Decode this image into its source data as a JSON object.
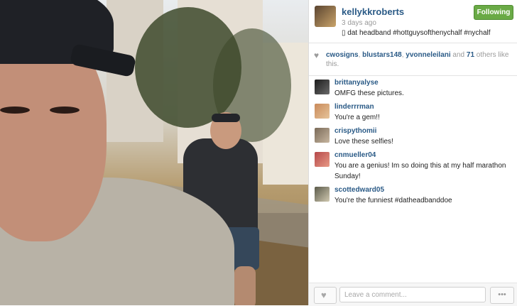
{
  "post": {
    "username": "kellykkroberts",
    "time_ago": "3 days ago",
    "caption": "▯ dat headband #hottguysofthenychalf #nychalf",
    "follow_label": "Following"
  },
  "likes": {
    "users": [
      "cwosigns",
      "blustars148",
      "yvonneleilani"
    ],
    "sep1": ", ",
    "sep2": ", ",
    "and_text": " and ",
    "others_count": "71",
    "tail_text": " others like this."
  },
  "comments": [
    {
      "user": "brittanyalyse",
      "text": "OMFG these pictures."
    },
    {
      "user": "linderrrman",
      "text": "You're a gem!!"
    },
    {
      "user": "crispythomii",
      "text": "Love these selfies!"
    },
    {
      "user": "cnmueller04",
      "text": "You are a genius! Im so doing this at my half marathon Sunday!"
    },
    {
      "user": "scottedward05",
      "text": "You're the funniest #datheadbanddoe"
    }
  ],
  "footer": {
    "comment_placeholder": "Leave a comment...",
    "more_label": "•••"
  },
  "icons": {
    "like": "heart-icon",
    "more": "more-options-icon"
  },
  "colors": {
    "username_blue": "#2a5a86",
    "following_green": "#6aaa46"
  }
}
